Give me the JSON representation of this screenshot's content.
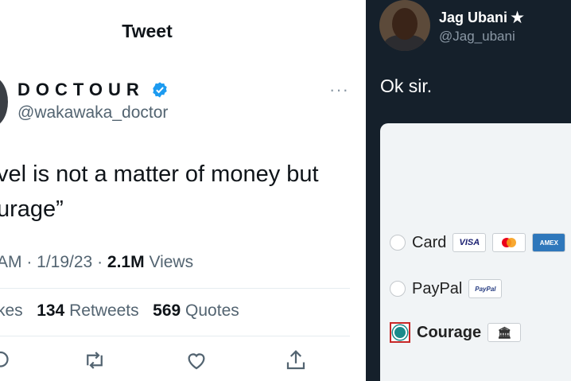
{
  "left_panel": {
    "header_title": "Tweet",
    "author_name": "DOCTOUR",
    "author_handle": "@wakawaka_doctor",
    "more_icon": "···",
    "tweet_line1": "vel is not a matter of money but",
    "tweet_line2": "urage”",
    "time": "AM",
    "date": "1/19/23",
    "views_count": "2.1M",
    "views_label": "Views",
    "likes_label": "kes",
    "retweets_count": "134",
    "retweets_label": "Retweets",
    "quotes_count": "569",
    "quotes_label": "Quotes",
    "icons": [
      "reply-icon",
      "retweet-icon",
      "like-icon",
      "share-icon"
    ],
    "accent_color": "#1d9bf0"
  },
  "right_panel": {
    "author_name": "Jag Ubani ✭",
    "author_handle": "@Jag_ubani",
    "message": "Ok sir.",
    "payment_options": [
      {
        "label": "Card",
        "selected": false,
        "badges": [
          "VISA",
          "mastercard",
          "AMEX"
        ]
      },
      {
        "label": "PayPal",
        "selected": false,
        "badges": [
          "PayPal"
        ]
      },
      {
        "label": "Courage",
        "selected": true,
        "badges": [
          "bank-icon"
        ]
      }
    ],
    "badge_text": {
      "visa": "VISA",
      "amex": "AMEX",
      "paypal": "PayPal",
      "bank": "🏛"
    },
    "background_color": "#15202b",
    "selected_color": "#1a8a8a"
  }
}
